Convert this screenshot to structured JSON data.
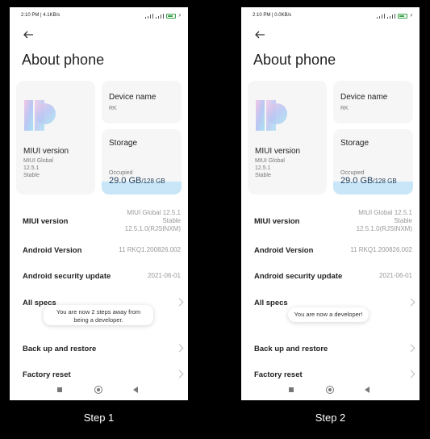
{
  "colors": {
    "background": "#000000",
    "screen": "#ffffff",
    "card": "#f6f6f6",
    "storage_fill": "#c9e6f8",
    "battery": "#3aa14a"
  },
  "steps": [
    {
      "label": "Step 1",
      "status": {
        "time_speed": "2:10 PM | 4.1KB/s"
      },
      "title": "About phone",
      "miui_card": {
        "title": "MIUI version",
        "lines": [
          "MIUI Global",
          "12.5.1",
          "Stable"
        ]
      },
      "device_card": {
        "title": "Device name",
        "value": "RK"
      },
      "storage_card": {
        "title": "Storage",
        "occupied_label": "Occupied",
        "used": "29.0 GB",
        "total": "/128 GB",
        "used_fraction": 0.23
      },
      "rows": [
        {
          "label": "MIUI version",
          "value_lines": [
            "MIUI Global 12.5.1",
            "Stable",
            "12.5.1.0(RJSINXM)"
          ]
        },
        {
          "label": "Android Version",
          "value_lines": [
            "11 RKQ1.200826.002"
          ]
        },
        {
          "label": "Android security update",
          "value_lines": [
            "2021-06-01"
          ]
        },
        {
          "label": "All specs",
          "value_lines": []
        },
        {
          "label": "Back up and restore",
          "value_lines": []
        },
        {
          "label": "Factory reset",
          "value_lines": []
        }
      ],
      "toast": "You are now 2 steps away from being a developer."
    },
    {
      "label": "Step 2",
      "status": {
        "time_speed": "2:10 PM | 0.0KB/s"
      },
      "title": "About phone",
      "miui_card": {
        "title": "MIUI version",
        "lines": [
          "MIUI Global",
          "12.5.1",
          "Stable"
        ]
      },
      "device_card": {
        "title": "Device name",
        "value": "RK"
      },
      "storage_card": {
        "title": "Storage",
        "occupied_label": "Occupied",
        "used": "29.0 GB",
        "total": "/128 GB",
        "used_fraction": 0.23
      },
      "rows": [
        {
          "label": "MIUI version",
          "value_lines": [
            "MIUI Global 12.5.1",
            "Stable",
            "12.5.1.0(RJSINXM)"
          ]
        },
        {
          "label": "Android Version",
          "value_lines": [
            "11 RKQ1.200826.002"
          ]
        },
        {
          "label": "Android security update",
          "value_lines": [
            "2021-06-01"
          ]
        },
        {
          "label": "All specs",
          "value_lines": []
        },
        {
          "label": "Back up and restore",
          "value_lines": []
        },
        {
          "label": "Factory reset",
          "value_lines": []
        }
      ],
      "toast": "You are now a developer!"
    }
  ]
}
